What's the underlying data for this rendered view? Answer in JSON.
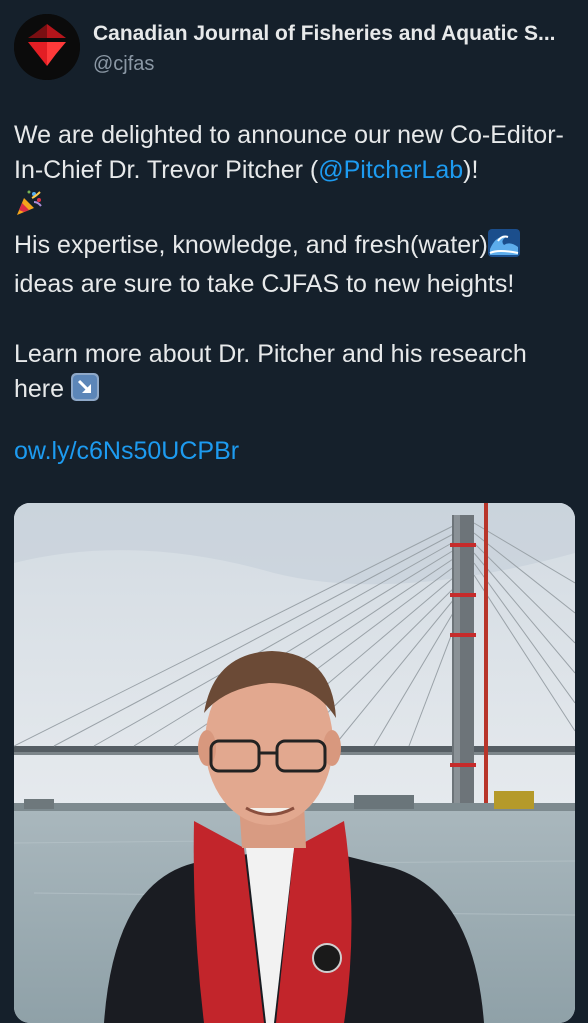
{
  "tweet": {
    "author_name": "Canadian Journal of Fisheries and Aquatic S...",
    "author_handle": "@cjfas",
    "text_line1": "We are delighted to announce our new Co-Editor-In-Chief Dr. Trevor Pitcher (",
    "mention": "@PitcherLab",
    "text_line1_end": ")!",
    "party_emoji": "party-popper-emoji",
    "text_line2": "His expertise, knowledge, and fresh(water)",
    "wave_emoji": "water-wave-emoji",
    "text_line3": "ideas are sure to take CJFAS to new heights!",
    "text_line4": "Learn more about Dr. Pitcher and his research here",
    "arrow_emoji": "down-right-arrow-emoji",
    "link": "ow.ly/c6Ns50UCPBr"
  },
  "media": {
    "photo_icon": "portrait-photo-bridge"
  },
  "colors": {
    "background": "#15202b",
    "link": "#1d9bf0",
    "secondary_text": "#8b98a5",
    "brand_red": "#e31e24"
  }
}
